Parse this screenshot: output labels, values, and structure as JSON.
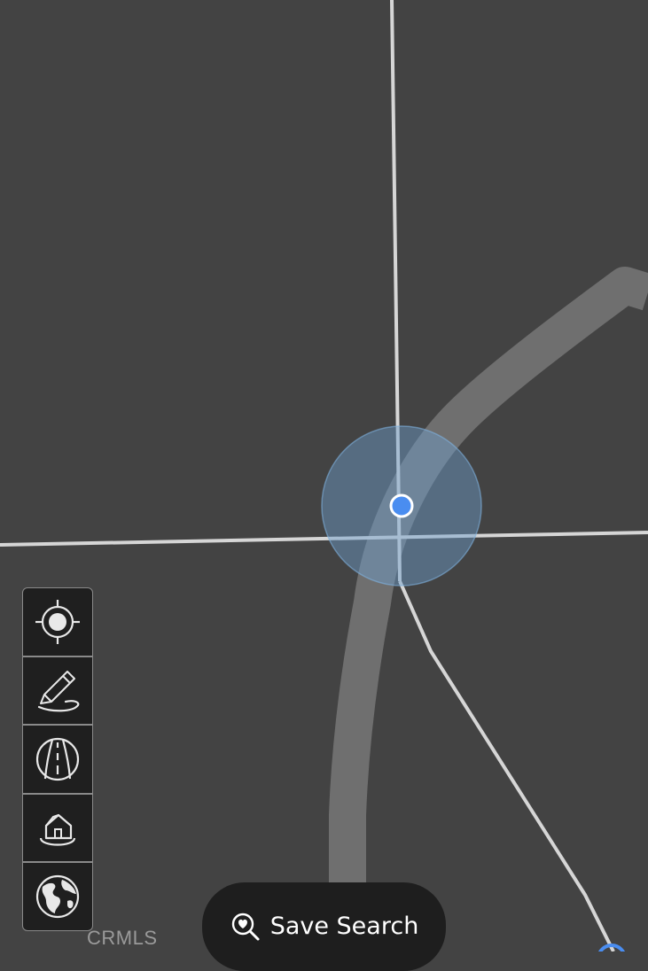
{
  "map": {
    "background_color": "#434343",
    "road_major_color": "#6f6f6f",
    "road_minor_color": "#d6d6d6",
    "location_accuracy_color": "#6f9fcf",
    "location_dot_color": "#4a8df0"
  },
  "toolbar": {
    "items": [
      {
        "icon": "locate-icon",
        "name": "current-location-button"
      },
      {
        "icon": "pencil-draw-icon",
        "name": "draw-area-button"
      },
      {
        "icon": "road-icon",
        "name": "road-layer-button"
      },
      {
        "icon": "house-icon",
        "name": "property-layer-button"
      },
      {
        "icon": "globe-icon",
        "name": "satellite-view-button"
      }
    ]
  },
  "attribution": {
    "text": "CRMLS"
  },
  "save_search": {
    "label": "Save Search",
    "icon": "heart-search-icon"
  }
}
